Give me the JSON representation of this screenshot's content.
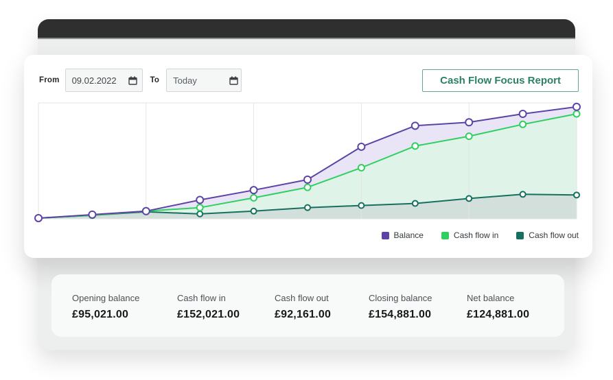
{
  "controls": {
    "from_label": "From",
    "from_value": "09.02.2022",
    "to_label": "To",
    "to_value": "Today",
    "report_button_label": "Cash Flow Focus Report"
  },
  "chart_data": {
    "type": "area",
    "x": [
      1,
      2,
      3,
      4,
      5,
      6,
      7,
      8,
      9,
      10,
      11
    ],
    "x_axis": "time (no tick labels shown)",
    "y_axis": "amount (no scale labels shown; values are relative units 0-160)",
    "grid": "vertical gridlines at every other point, top and baseline border lines",
    "legend_position": "bottom-right",
    "series": [
      {
        "name": "Balance",
        "color": "#5d43a6",
        "fill": "#eae5f6",
        "values": [
          1,
          6,
          11,
          27,
          41,
          56,
          103,
          133,
          138,
          150,
          160
        ]
      },
      {
        "name": "Cash flow in",
        "color": "#2ed060",
        "fill": "#e0f3e8",
        "values": [
          1,
          5,
          11,
          16,
          30,
          45,
          73,
          104,
          118,
          135,
          150
        ]
      },
      {
        "name": "Cash flow out",
        "color": "#17705f",
        "fill": "#d2dfdb",
        "values": [
          1,
          5,
          10,
          7,
          11,
          16,
          19,
          22,
          29,
          35,
          34
        ]
      }
    ]
  },
  "summary": {
    "items": [
      {
        "label": "Opening balance",
        "value": "£95,021.00"
      },
      {
        "label": "Cash flow in",
        "value": "£152,021.00"
      },
      {
        "label": "Cash flow out",
        "value": "£92,161.00"
      },
      {
        "label": "Closing balance",
        "value": "£154,881.00"
      },
      {
        "label": "Net balance",
        "value": "£124,881.00"
      }
    ]
  },
  "colors": {
    "accent_green": "#2c8066",
    "titlebar_dark": "#2f2f2f",
    "gridline": "#e2e5e5"
  }
}
